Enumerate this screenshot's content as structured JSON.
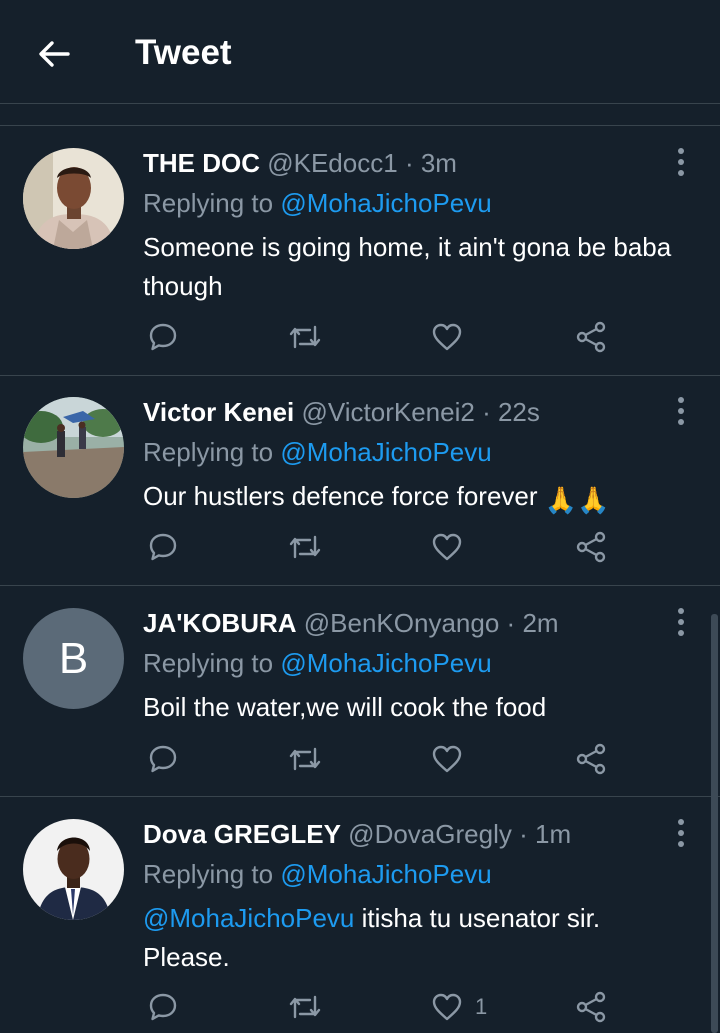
{
  "header": {
    "title": "Tweet",
    "back_icon": "arrow-left-icon"
  },
  "replying_label": "Replying to",
  "tweets": [
    {
      "name": "THE DOC",
      "handle": "@KEdocc1",
      "separator": "·",
      "time": "3m",
      "replying_to": "@MohaJichoPevu",
      "text": "Someone is going home, it ain't gona be baba though",
      "likes": ""
    },
    {
      "name": "Victor Kenei",
      "handle": "@VictorKenei2",
      "separator": "·",
      "time": "22s",
      "replying_to": "@MohaJichoPevu",
      "text": "Our hustlers defence force forever",
      "emoji": "🙏🙏",
      "likes": ""
    },
    {
      "name": "JA'KOBURA",
      "handle": "@BenKOnyango",
      "separator": "·",
      "time": "2m",
      "replying_to": "@MohaJichoPevu",
      "avatar_letter": "B",
      "text": "Boil the water,we will cook the food",
      "likes": ""
    },
    {
      "name": "Dova GREGLEY",
      "handle": "@DovaGregly",
      "separator": "·",
      "time": "1m",
      "replying_to": "@MohaJichoPevu",
      "mention": "@MohaJichoPevu",
      "text": "itisha tu usenator sir. Please.",
      "likes": "1"
    }
  ],
  "colors": {
    "background": "#15202b",
    "accent": "#1d9bf0",
    "muted": "#8b98a5",
    "divider": "#38444d"
  }
}
